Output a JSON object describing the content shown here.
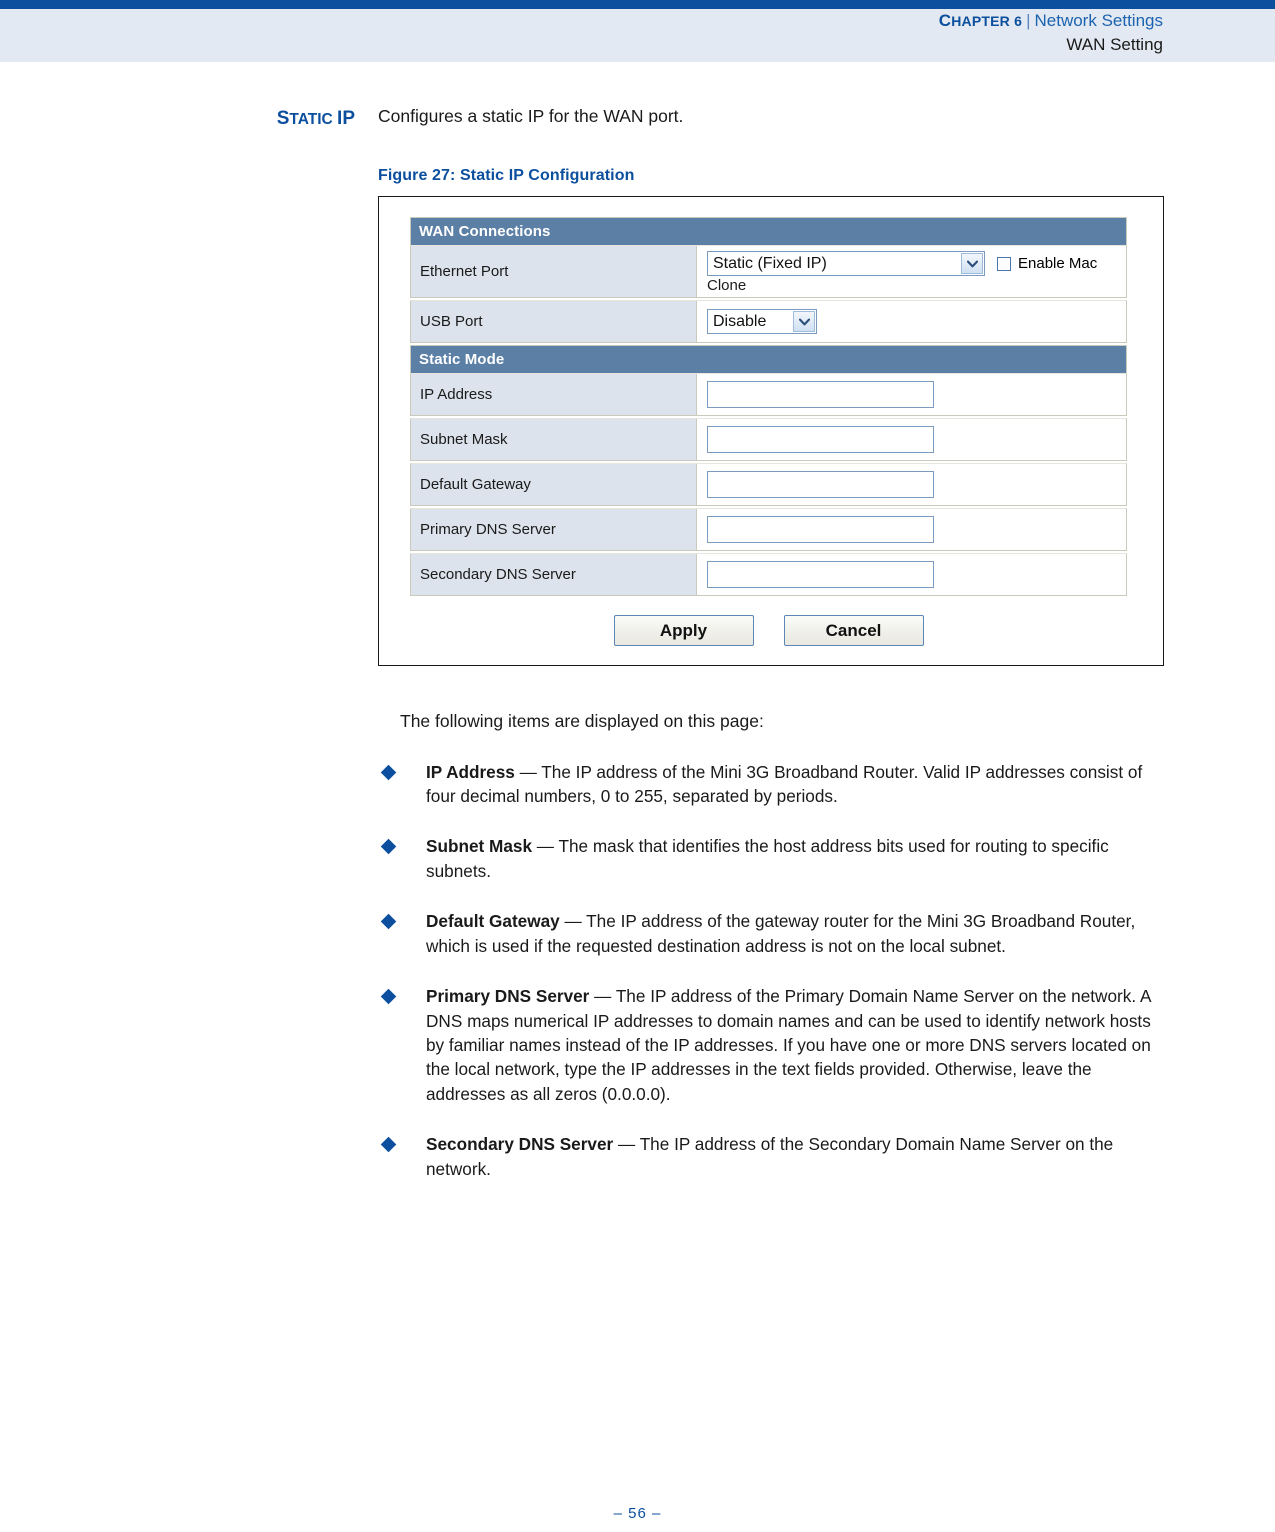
{
  "header": {
    "chapter_label": "Chapter 6",
    "chapter_cap": "C",
    "chapter_rest": "HAPTER 6",
    "separator": "|",
    "section": "Network Settings",
    "subsection": "WAN Setting",
    "topbar_color": "#0B4F9E",
    "band_color": "#E3E9F2"
  },
  "margin_heading": {
    "cap": "S",
    "rest": "TATIC ",
    "cap2": "IP",
    "full": "Static IP"
  },
  "intro": {
    "text": "Configures a static IP for the WAN port."
  },
  "figure": {
    "caption": "Figure 27:  Static IP Configuration",
    "caption_number": "Figure 27:",
    "caption_title": "Static IP Configuration"
  },
  "router_ui": {
    "section1_title": "WAN Connections",
    "section2_title": "Static Mode",
    "rows_connections": [
      {
        "label": "Ethernet Port",
        "control": "select",
        "value": "Static (Fixed IP)",
        "extra_text": "Clone",
        "checkbox_label": "Enable Mac",
        "checkbox_checked": false
      },
      {
        "label": "USB Port",
        "control": "select",
        "value": "Disable"
      }
    ],
    "rows_static": [
      {
        "label": "IP Address",
        "value": "",
        "placeholder": ""
      },
      {
        "label": "Subnet Mask",
        "value": "",
        "placeholder": ""
      },
      {
        "label": "Default Gateway",
        "value": "",
        "placeholder": ""
      },
      {
        "label": "Primary DNS Server",
        "value": "",
        "placeholder": ""
      },
      {
        "label": "Secondary DNS Server",
        "value": "",
        "placeholder": ""
      }
    ],
    "buttons": {
      "apply": "Apply",
      "cancel": "Cancel"
    },
    "colors": {
      "section_header_bg": "#5C7FA6",
      "label_cell_bg": "#DCE3EC",
      "input_border": "#7C9BC0"
    }
  },
  "body": {
    "lead": "The following items are displayed on this page:",
    "bullets": [
      {
        "term": "IP Address",
        "dash": " — ",
        "text": "The IP address of the Mini 3G Broadband Router. Valid IP addresses consist of four decimal numbers, 0 to 255, separated by periods."
      },
      {
        "term": "Subnet Mask",
        "dash": " — ",
        "text": "The mask that identifies the host address bits used for routing to specific subnets."
      },
      {
        "term": "Default Gateway",
        "dash": " — ",
        "text": "The IP address of the gateway router for the Mini 3G Broadband Router, which is used if the requested destination address is not on the local subnet."
      },
      {
        "term": "Primary DNS Server",
        "dash": " — ",
        "text": "The IP address of the Primary Domain Name Server on the network. A DNS maps numerical IP addresses to domain names and can be used to identify network hosts by familiar names instead of the IP addresses. If you have one or more DNS servers located on the local network, type the IP addresses in the text fields provided. Otherwise, leave the addresses as all zeros (0.0.0.0)."
      },
      {
        "term": "Secondary DNS Server",
        "dash": " — ",
        "text": "The IP address of the Secondary Domain Name Server on the network."
      }
    ]
  },
  "footer": {
    "page": "–  56  –"
  }
}
